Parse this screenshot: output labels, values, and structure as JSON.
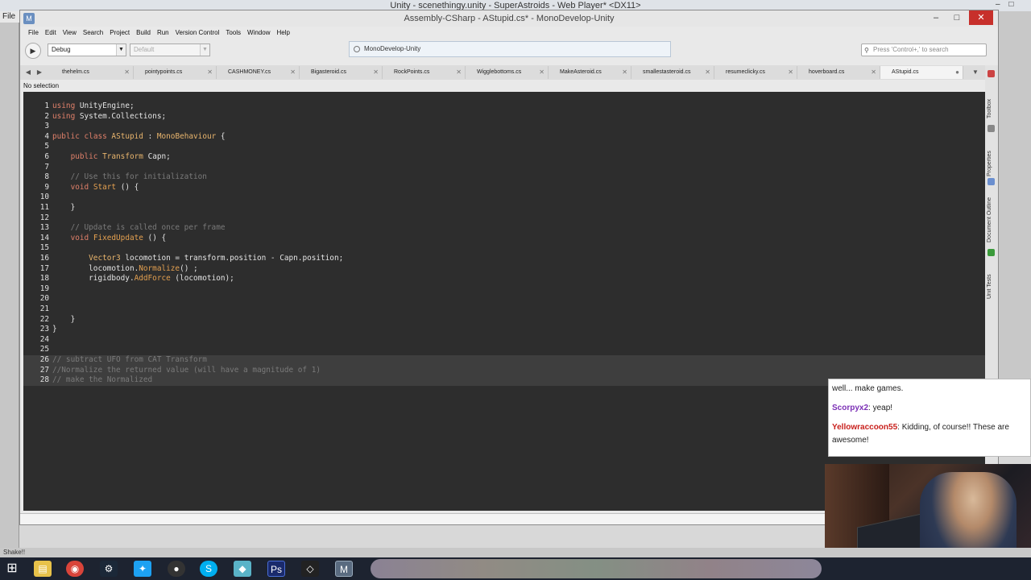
{
  "unity": {
    "title": "Unity - scenethingy.unity - SuperAstroids - Web Player* <DX11>",
    "menu_file": "File",
    "status_text": "Shake!!"
  },
  "window": {
    "title": "Assembly-CSharp - AStupid.cs* - MonoDevelop-Unity",
    "minimize": "–",
    "maximize": "□",
    "close": "✕"
  },
  "menubar": [
    "File",
    "Edit",
    "View",
    "Search",
    "Project",
    "Build",
    "Run",
    "Version Control",
    "Tools",
    "Window",
    "Help"
  ],
  "toolbar": {
    "config": "Debug",
    "platform": "Default",
    "status": "MonoDevelop-Unity",
    "search_placeholder": "Press 'Control+,' to search"
  },
  "tabs": [
    "thehelm.cs",
    "pointypoints.cs",
    "CASHMONEY.cs",
    "Bigasteroid.cs",
    "RockPoints.cs",
    "Wigglebottoms.cs",
    "MakeAsteroid.cs",
    "smallestasteroid.cs",
    "resumeclicky.cs",
    "hoverboard.cs",
    "AStupid.cs"
  ],
  "active_tab": "AStupid.cs",
  "selection_status": "No selection",
  "code_lines": [
    {
      "n": "1",
      "text": "using UnityEngine;"
    },
    {
      "n": "2",
      "text": "using System.Collections;"
    },
    {
      "n": "3",
      "text": ""
    },
    {
      "n": "4",
      "text": "public class AStupid : MonoBehaviour {"
    },
    {
      "n": "5",
      "text": ""
    },
    {
      "n": "6",
      "text": "    public Transform Capn;"
    },
    {
      "n": "7",
      "text": ""
    },
    {
      "n": "8",
      "text": "    // Use this for initialization"
    },
    {
      "n": "9",
      "text": "    void Start () {"
    },
    {
      "n": "10",
      "text": ""
    },
    {
      "n": "11",
      "text": "    }"
    },
    {
      "n": "12",
      "text": ""
    },
    {
      "n": "13",
      "text": "    // Update is called once per frame"
    },
    {
      "n": "14",
      "text": "    void FixedUpdate () {"
    },
    {
      "n": "15",
      "text": ""
    },
    {
      "n": "16",
      "text": "        Vector3 locomotion = transform.position - Capn.position;"
    },
    {
      "n": "17",
      "text": "        locomotion.Normalize() ;"
    },
    {
      "n": "18",
      "text": "        rigidbody.AddForce (locomotion);"
    },
    {
      "n": "19",
      "text": ""
    },
    {
      "n": "20",
      "text": ""
    },
    {
      "n": "21",
      "text": ""
    },
    {
      "n": "22",
      "text": "    }"
    },
    {
      "n": "23",
      "text": "}"
    },
    {
      "n": "24",
      "text": ""
    },
    {
      "n": "25",
      "text": ""
    },
    {
      "n": "26",
      "text": "// subtract UFO from CAT Transform"
    },
    {
      "n": "27",
      "text": "//Normalize the returned value (will have a magnitude of 1)"
    },
    {
      "n": "28",
      "text": "// make the Normalized"
    }
  ],
  "pads": [
    "Toolbox",
    "Properties",
    "Document Outline",
    "Unit Tests"
  ],
  "chat": [
    {
      "user": "",
      "text": "well... make games.",
      "color": "#222222"
    },
    {
      "user": "Scorpyx2",
      "text": "yeap!",
      "color": "#7b2fb5"
    },
    {
      "user": "Yellowraccoon55",
      "text": "Kidding, of course!! These are awesome!",
      "color": "#c8201c"
    }
  ],
  "taskbar_icons": [
    "windows-icon",
    "file-explorer-icon",
    "chrome-icon",
    "steam-icon",
    "twitter-icon",
    "obs-icon",
    "skype-icon",
    "sketch-icon",
    "photoshop-icon",
    "unity-icon",
    "monodevelop-icon"
  ]
}
